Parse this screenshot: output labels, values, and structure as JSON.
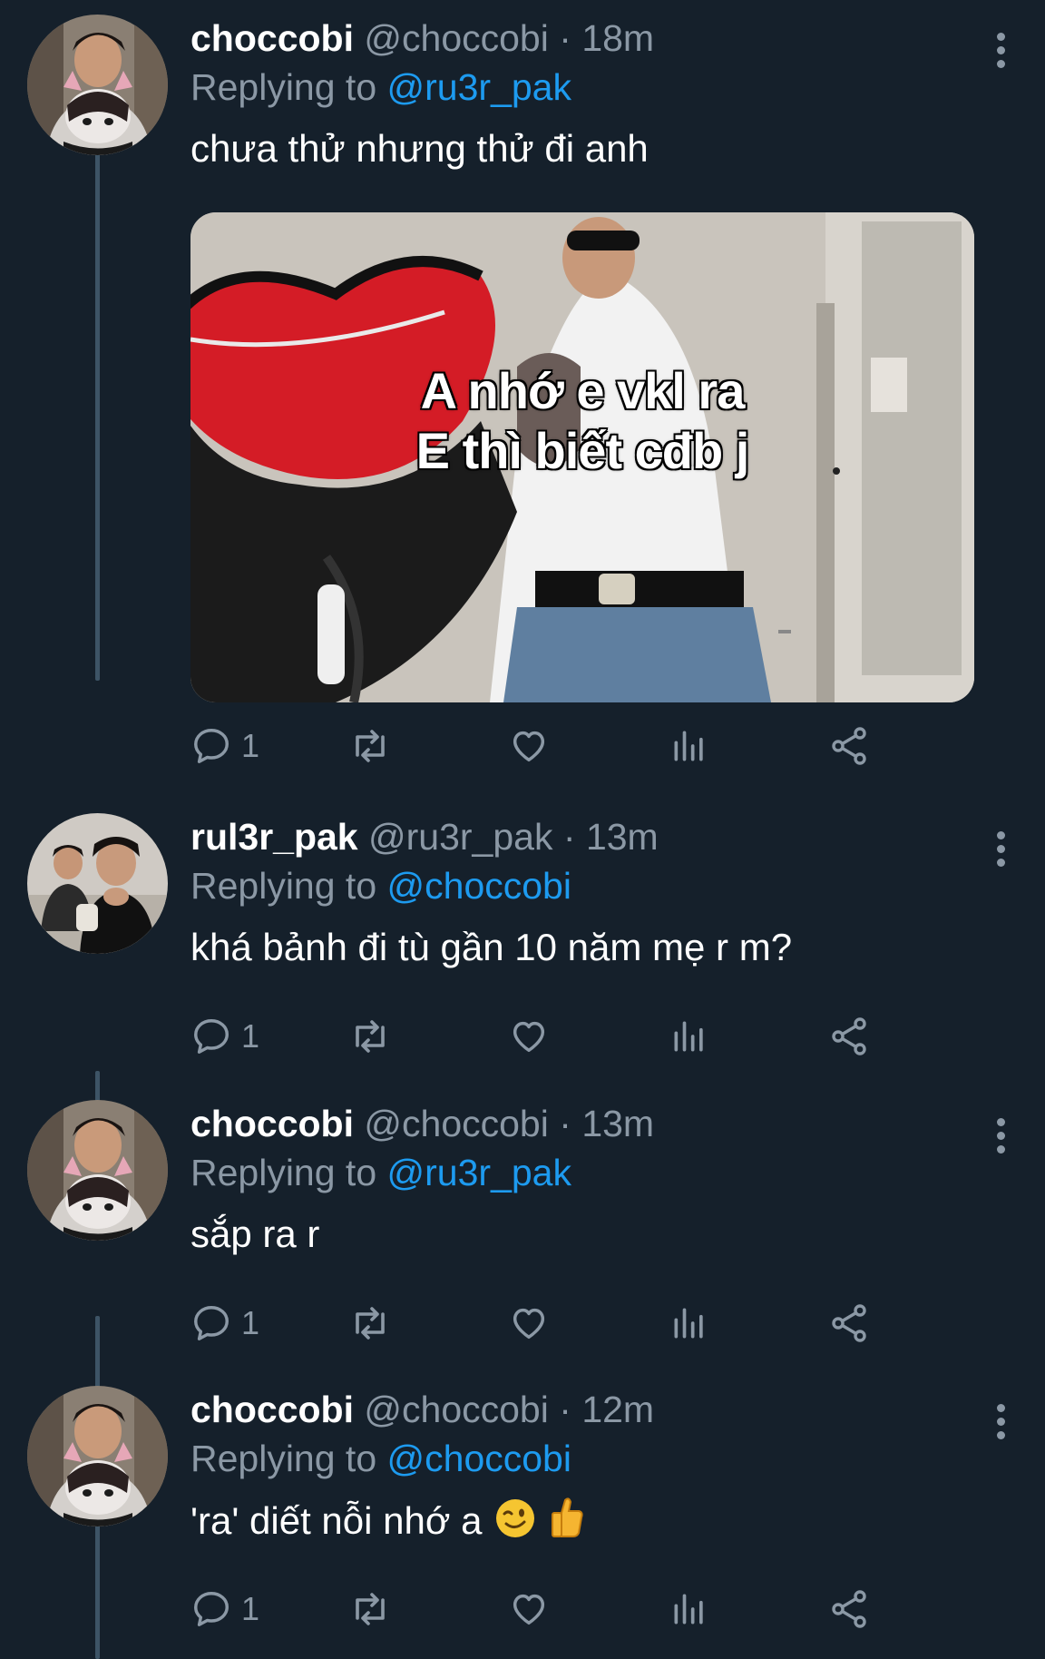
{
  "colors": {
    "background": "#15202b",
    "text_primary": "#ffffff",
    "text_secondary": "#8b98a5",
    "accent": "#1d9bf0",
    "thread_line": "#3d5466"
  },
  "tweets": [
    {
      "display_name": "choccobi",
      "handle": "@choccobi",
      "time": "18m",
      "replying_prefix": "Replying to",
      "replying_to": "@ru3r_pak",
      "text": "chưa thử nhưng thử đi anh",
      "media": {
        "caption_line1": "A nhớ e vkl ra",
        "caption_line2": "E thì biết cđb j"
      },
      "reply_count": "1"
    },
    {
      "display_name": "rul3r_pak",
      "handle": "@ru3r_pak",
      "time": "13m",
      "replying_prefix": "Replying to",
      "replying_to": "@choccobi",
      "text": "khá bảnh đi tù gần 10 năm mẹ r m?",
      "reply_count": "1"
    },
    {
      "display_name": "choccobi",
      "handle": "@choccobi",
      "time": "13m",
      "replying_prefix": "Replying to",
      "replying_to": "@ru3r_pak",
      "text": "sắp ra r",
      "reply_count": "1"
    },
    {
      "display_name": "choccobi",
      "handle": "@choccobi",
      "time": "12m",
      "replying_prefix": "Replying to",
      "replying_to": "@choccobi",
      "text": "'ra' diết nỗi nhớ a",
      "emojis": [
        "winking-face-emoji",
        "thumbs-up-emoji"
      ],
      "reply_count": "1"
    }
  ],
  "separator": "·",
  "icons": [
    "reply-icon",
    "retweet-icon",
    "like-icon",
    "views-icon",
    "share-icon",
    "more-icon"
  ]
}
